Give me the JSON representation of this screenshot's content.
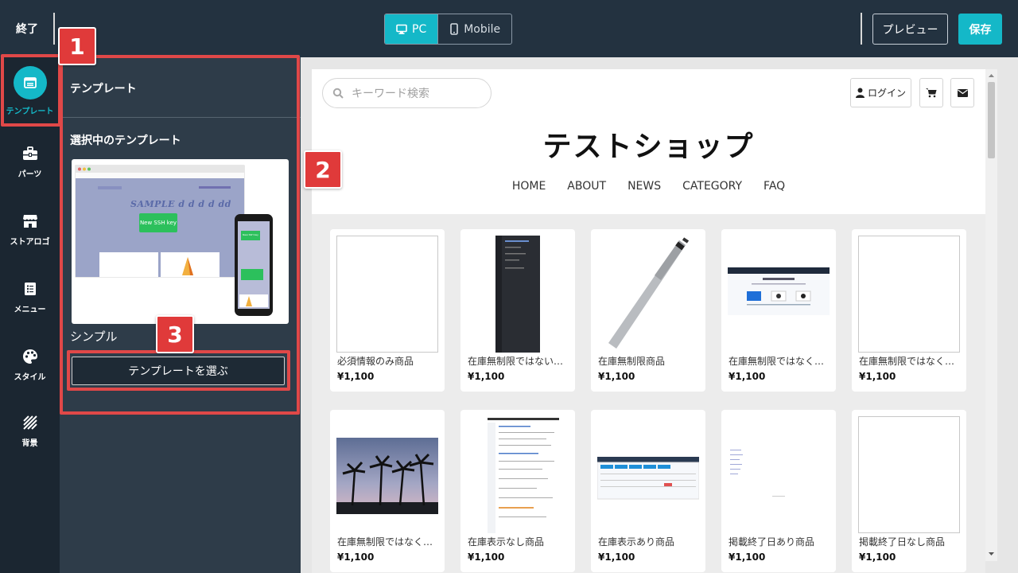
{
  "topbar": {
    "exit_label": "終了",
    "devices": [
      {
        "label": "PC",
        "active": true,
        "icon": "monitor-icon"
      },
      {
        "label": "Mobile",
        "active": false,
        "icon": "smartphone-icon"
      }
    ],
    "preview_label": "プレビュー",
    "save_label": "保存"
  },
  "sidebar": {
    "items": [
      {
        "label": "テンプレート",
        "icon": "template-icon",
        "active": true
      },
      {
        "label": "パーツ",
        "icon": "toolbox-icon",
        "active": false
      },
      {
        "label": "ストアロゴ",
        "icon": "store-icon",
        "active": false
      },
      {
        "label": "メニュー",
        "icon": "menu-list-icon",
        "active": false
      },
      {
        "label": "スタイル",
        "icon": "palette-icon",
        "active": false
      },
      {
        "label": "背景",
        "icon": "stripes-icon",
        "active": false
      }
    ]
  },
  "panel": {
    "title": "テンプレート",
    "selected_heading": "選択中のテンプレート",
    "template_name": "シンプル",
    "choose_button": "テンプレートを選ぶ",
    "thumbnail": {
      "heading": "SAMPLE d d d d dd",
      "button_label": "New SSH key",
      "phone_button_label": "New SSH key"
    }
  },
  "annotations": [
    "1",
    "2",
    "3"
  ],
  "shop": {
    "search_placeholder": "キーワード検索",
    "login_label": "ログイン",
    "title": "テストショップ",
    "nav": [
      "HOME",
      "ABOUT",
      "NEWS",
      "CATEGORY",
      "FAQ"
    ],
    "products": [
      {
        "name": "必須情報のみ商品",
        "price": "¥1,100",
        "image": "broken"
      },
      {
        "name": "在庫無制限ではない商品",
        "price": "¥1,100",
        "image": "dark-screenshot"
      },
      {
        "name": "在庫無制限商品",
        "price": "¥1,100",
        "image": "baseball-bat"
      },
      {
        "name": "在庫無制限ではなく在庫あり商品",
        "price": "¥1,100",
        "image": "website-screenshot"
      },
      {
        "name": "在庫無制限ではなく在庫なし商品",
        "price": "¥1,100",
        "image": "broken"
      },
      {
        "name": "在庫無制限ではなく予約商品",
        "price": "¥1,100",
        "image": "palm-trees"
      },
      {
        "name": "在庫表示なし商品",
        "price": "¥1,100",
        "image": "document-screenshot"
      },
      {
        "name": "在庫表示あり商品",
        "price": "¥1,100",
        "image": "dashboard-screenshot"
      },
      {
        "name": "掲載終了日あり商品",
        "price": "¥1,100",
        "image": "text-screenshot"
      },
      {
        "name": "掲載終了日なし商品",
        "price": "¥1,100",
        "image": "broken"
      }
    ]
  },
  "colors": {
    "accent": "#14b8c8",
    "topbar": "#233240",
    "sidebar": "#1b2631",
    "panel": "#2e3c49",
    "annotation": "#e03a3a"
  }
}
